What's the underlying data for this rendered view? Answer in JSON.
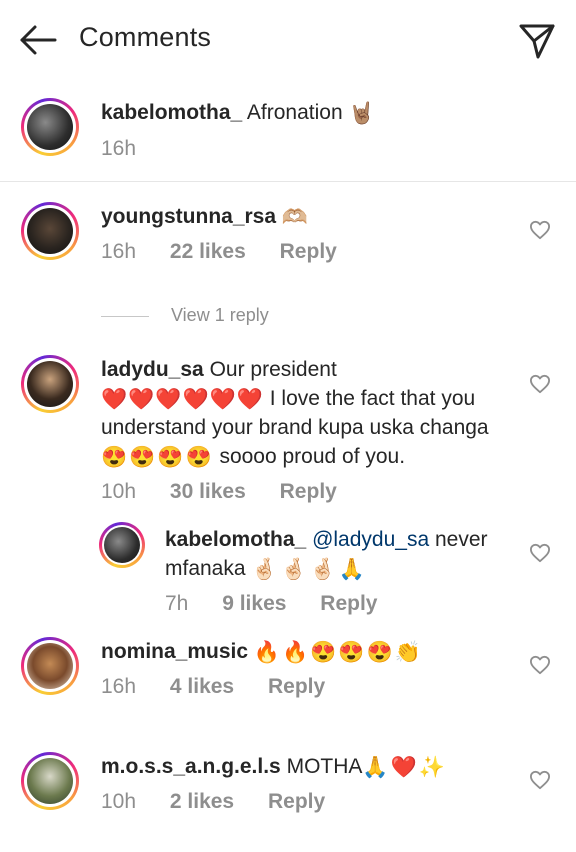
{
  "header": {
    "title": "Comments"
  },
  "caption": {
    "username": "kabelomotha_",
    "text": "Afronation",
    "emoji": "🤘🏽",
    "time": "16h"
  },
  "comments": [
    {
      "username": "youngstunna_rsa",
      "emoji": "🫶🏼",
      "time": "16h",
      "likes": "22 likes",
      "reply": "Reply"
    },
    {
      "view_replies": "View 1 reply"
    },
    {
      "username": "ladydu_sa",
      "text_line1": "Our president",
      "hearts": "❤️❤️❤️❤️❤️❤️",
      "text_line2": "I love the fact that you",
      "text_line3": "understand your brand kupa uska changa",
      "heart_eyes": "😍😍😍😍",
      "text_line4": "soooo proud of you.",
      "time": "10h",
      "likes": "30 likes",
      "reply": "Reply"
    },
    {
      "username": "kabelomotha_",
      "mention": "@ladydu_sa",
      "text_line1": "never",
      "text_line2": "mfanaka",
      "emoji": "🤞🏻🤞🏻🤞🏻🙏",
      "time": "7h",
      "likes": "9 likes",
      "reply": "Reply"
    },
    {
      "username": "nomina_music",
      "emoji": "🔥🔥😍😍😍👏",
      "time": "16h",
      "likes": "4 likes",
      "reply": "Reply"
    },
    {
      "username": "m.o.s.s_a.n.g.e.l.s",
      "text": "MOTHA",
      "emoji": "🙏❤️✨",
      "time": "10h",
      "likes": "2 likes",
      "reply": "Reply"
    }
  ],
  "colors": {
    "text": "#262626",
    "meta": "#8e8e8e",
    "mention": "#00376b",
    "heart_red": "#ed1c24"
  }
}
